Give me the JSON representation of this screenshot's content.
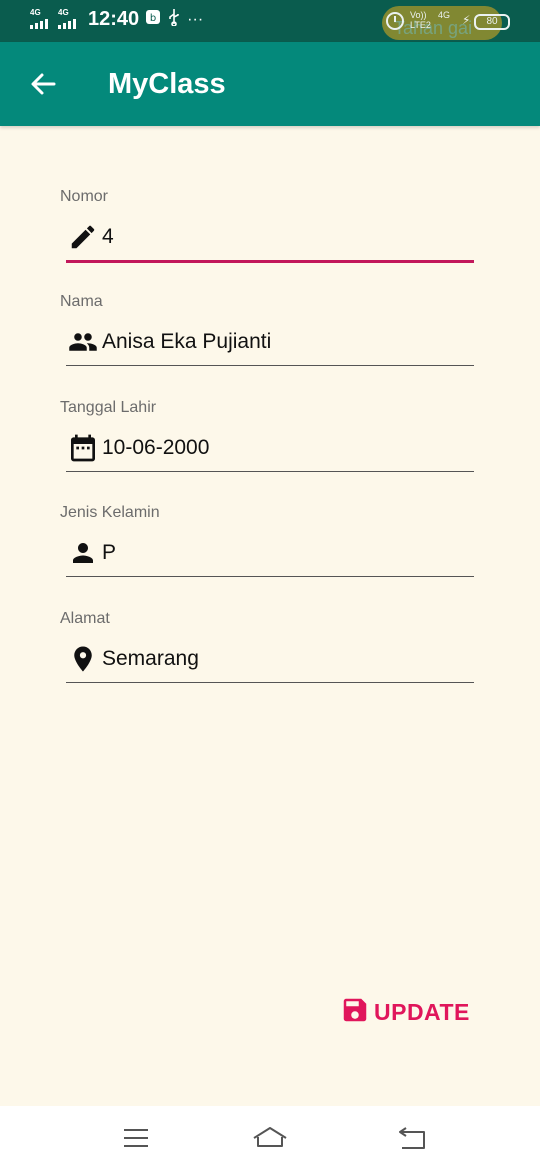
{
  "status_bar": {
    "signal1_label": "4G",
    "signal2_label": "4G",
    "time": "12:40",
    "volte": "Vo))",
    "lte": "LTE2",
    "net": "4G",
    "battery": "80",
    "ghost_text": "Tahan gai"
  },
  "app_bar": {
    "title": "MyClass",
    "back_icon": "arrow-left-icon"
  },
  "form": {
    "fields": [
      {
        "label": "Nomor",
        "value": "4",
        "icon": "pencil-icon"
      },
      {
        "label": "Nama",
        "value": "Anisa Eka Pujianti",
        "icon": "people-icon"
      },
      {
        "label": "Tanggal Lahir",
        "value": "10-06-2000",
        "icon": "calendar-icon"
      },
      {
        "label": "Jenis Kelamin",
        "value": "P",
        "icon": "person-icon"
      },
      {
        "label": "Alamat",
        "value": "Semarang",
        "icon": "location-pin-icon"
      }
    ]
  },
  "update_button": {
    "label": "UPDATE",
    "icon": "save-icon"
  },
  "nav_bar": {
    "icons": [
      "menu-icon",
      "home-icon",
      "back-icon"
    ]
  },
  "colors": {
    "status_bar": "#0a5c4e",
    "app_bar": "#04897b",
    "background": "#fdf8ea",
    "accent": "#c2185b",
    "update": "#e0165b"
  }
}
